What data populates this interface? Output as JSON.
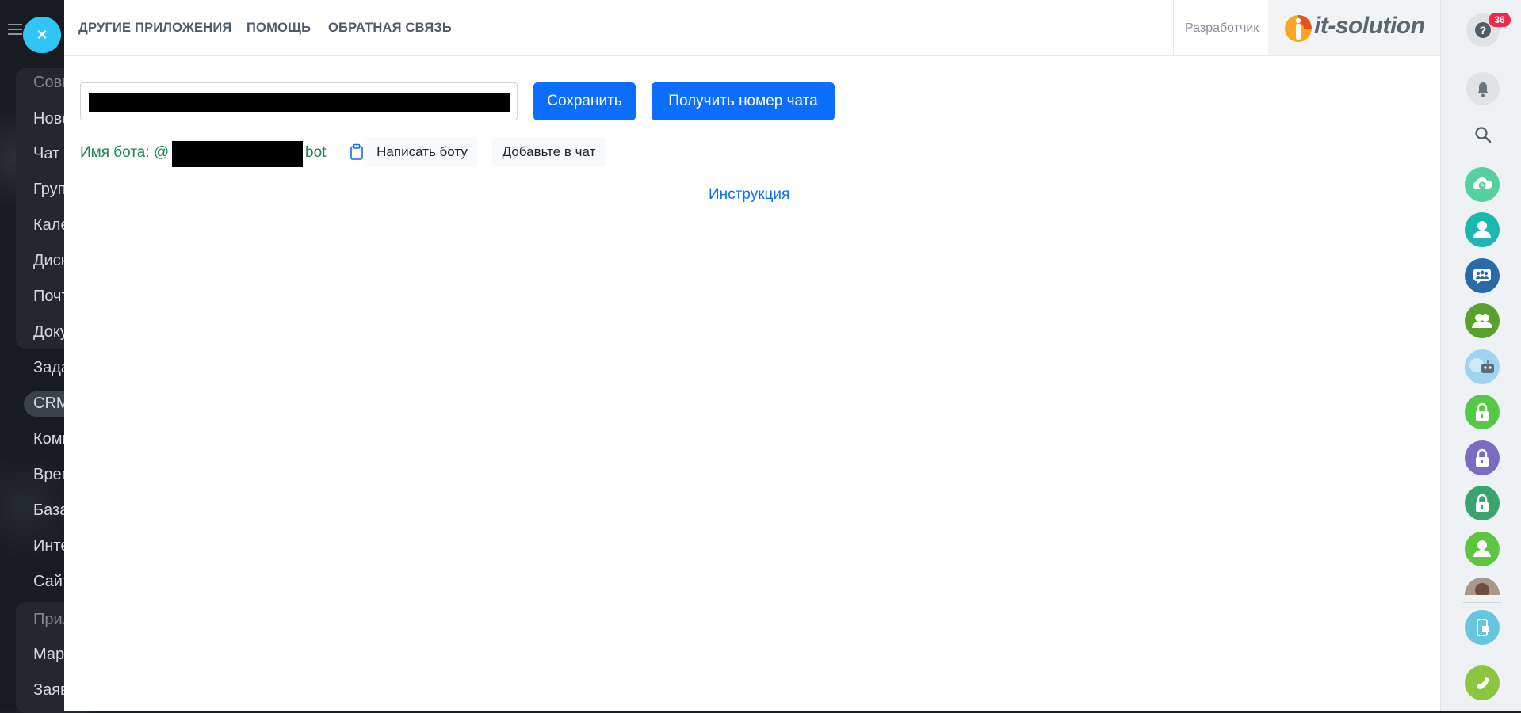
{
  "sidebar": {
    "items": [
      {
        "label": "Совм",
        "section": true
      },
      {
        "label": "Нове"
      },
      {
        "label": "Чат"
      },
      {
        "label": "Груп"
      },
      {
        "label": "Кале"
      },
      {
        "label": "Диск"
      },
      {
        "label": "Почт"
      },
      {
        "label": "Доку"
      },
      {
        "label": "Зада"
      },
      {
        "label": "CRM"
      },
      {
        "label": "Комп"
      },
      {
        "label": "Врем"
      },
      {
        "label": "База"
      },
      {
        "label": "Инте"
      },
      {
        "label": "Сайт"
      },
      {
        "label": "Прил",
        "section": true
      },
      {
        "label": "Мар"
      },
      {
        "label": "Заяв"
      }
    ]
  },
  "slider": {
    "close_icon": "close-icon",
    "close_glyph": "×"
  },
  "header": {
    "nav": [
      {
        "label": "ДРУГИЕ ПРИЛОЖЕНИЯ"
      },
      {
        "label": "ПОМОЩЬ"
      },
      {
        "label": "ОБРАТНАЯ СВЯЗЬ"
      }
    ],
    "developer_label": "Разработчик",
    "logo_text": "it-solution"
  },
  "form": {
    "token_value": "",
    "save_label": "Сохранить",
    "get_chat_label": "Получить номер чата",
    "bot_name_prefix": "Имя бота: @",
    "bot_name_suffix": "bot",
    "write_bot_label": "Написать боту",
    "add_to_chat_label": "Добавьте в чат",
    "instruction_label": "Инструкция"
  },
  "right_rail": {
    "notifications_badge": "36",
    "items": [
      {
        "name": "help-icon",
        "color": "#dfe3e6"
      },
      {
        "name": "bell-icon",
        "color": "#dfe3e6"
      },
      {
        "name": "search-icon",
        "color": "none"
      },
      {
        "name": "cloud-clock-icon",
        "color": "#55d0a1"
      },
      {
        "name": "user-icon",
        "color": "#1bb8b0"
      },
      {
        "name": "group-chat-icon",
        "color": "#2a6aa9"
      },
      {
        "name": "users-icon",
        "color": "#5aa02c"
      },
      {
        "name": "robot-icon",
        "color": "#9fd3f0"
      },
      {
        "name": "lock-icon",
        "color": "#55c945"
      },
      {
        "name": "lock-icon",
        "color": "#7b6bc1"
      },
      {
        "name": "lock-icon",
        "color": "#3aa470"
      },
      {
        "name": "user-icon",
        "color": "#5fc43f"
      },
      {
        "name": "avatar",
        "color": "#8a7a6a"
      },
      {
        "name": "phone-screen-icon",
        "color": "#65c6dd"
      },
      {
        "name": "phone-icon",
        "color": "#8cc63e"
      }
    ]
  }
}
